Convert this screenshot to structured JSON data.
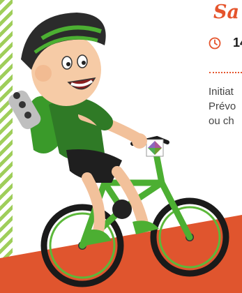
{
  "header": {
    "title": "Sa",
    "time": "14"
  },
  "description": {
    "line1": "Initiat",
    "line2": "Prévo",
    "line3": "ou ch"
  },
  "icons": {
    "clock": "clock-icon",
    "bike_logo": "app-logo-icon"
  },
  "colors": {
    "accent": "#e5542c",
    "green": "#4caf32",
    "dark_green": "#2f7a26",
    "stripe": "#9fce5a",
    "track": "#e0552e"
  }
}
